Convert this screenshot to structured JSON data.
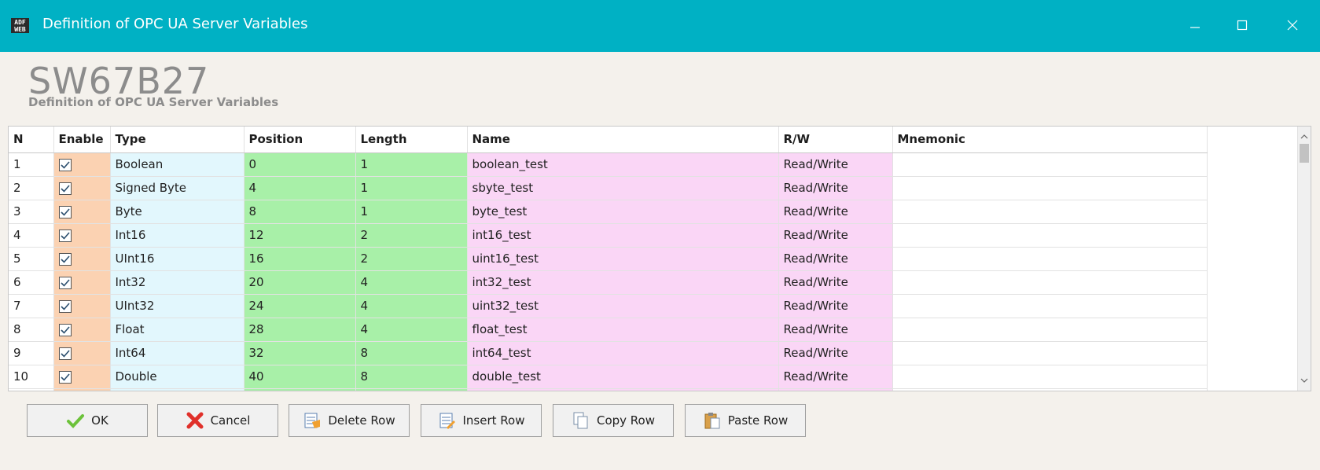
{
  "window": {
    "title": "Definition of OPC UA Server Variables",
    "icon_text": "ADF WEB"
  },
  "header": {
    "brand": "SW67B27",
    "subtitle": "Definition of OPC UA Server Variables"
  },
  "grid": {
    "columns": [
      "N",
      "Enable",
      "Type",
      "Position",
      "Length",
      "Name",
      "R/W",
      "Mnemonic"
    ],
    "rows": [
      {
        "n": "1",
        "enabled": true,
        "type": "Boolean",
        "position": "0",
        "length": "1",
        "name": "boolean_test",
        "rw": "Read/Write",
        "mnemonic": ""
      },
      {
        "n": "2",
        "enabled": true,
        "type": "Signed Byte",
        "position": "4",
        "length": "1",
        "name": "sbyte_test",
        "rw": "Read/Write",
        "mnemonic": ""
      },
      {
        "n": "3",
        "enabled": true,
        "type": "Byte",
        "position": "8",
        "length": "1",
        "name": "byte_test",
        "rw": "Read/Write",
        "mnemonic": ""
      },
      {
        "n": "4",
        "enabled": true,
        "type": "Int16",
        "position": "12",
        "length": "2",
        "name": "int16_test",
        "rw": "Read/Write",
        "mnemonic": ""
      },
      {
        "n": "5",
        "enabled": true,
        "type": "UInt16",
        "position": "16",
        "length": "2",
        "name": "uint16_test",
        "rw": "Read/Write",
        "mnemonic": ""
      },
      {
        "n": "6",
        "enabled": true,
        "type": "Int32",
        "position": "20",
        "length": "4",
        "name": "int32_test",
        "rw": "Read/Write",
        "mnemonic": ""
      },
      {
        "n": "7",
        "enabled": true,
        "type": "UInt32",
        "position": "24",
        "length": "4",
        "name": "uint32_test",
        "rw": "Read/Write",
        "mnemonic": ""
      },
      {
        "n": "8",
        "enabled": true,
        "type": "Float",
        "position": "28",
        "length": "4",
        "name": "float_test",
        "rw": "Read/Write",
        "mnemonic": ""
      },
      {
        "n": "9",
        "enabled": true,
        "type": "Int64",
        "position": "32",
        "length": "8",
        "name": "int64_test",
        "rw": "Read/Write",
        "mnemonic": ""
      },
      {
        "n": "10",
        "enabled": true,
        "type": "Double",
        "position": "40",
        "length": "8",
        "name": "double_test",
        "rw": "Read/Write",
        "mnemonic": ""
      },
      {
        "n": "",
        "enabled": true,
        "type": "",
        "position": "",
        "length": "",
        "name": "",
        "rw": "",
        "mnemonic": ""
      }
    ]
  },
  "buttons": [
    {
      "label": "OK",
      "icon": "checkmark-icon"
    },
    {
      "label": "Cancel",
      "icon": "cross-icon"
    },
    {
      "label": "Delete Row",
      "icon": "delete-row-icon"
    },
    {
      "label": "Insert Row",
      "icon": "insert-row-icon"
    },
    {
      "label": "Copy Row",
      "icon": "copy-icon"
    },
    {
      "label": "Paste Row",
      "icon": "paste-icon"
    }
  ],
  "colors": {
    "titlebar": "#00b1c4",
    "enable_column": "#fbd2b2",
    "type_column": "#e2f7fd",
    "position_length_columns": "#a8f0a8",
    "name_rw_columns": "#fad6f6"
  }
}
